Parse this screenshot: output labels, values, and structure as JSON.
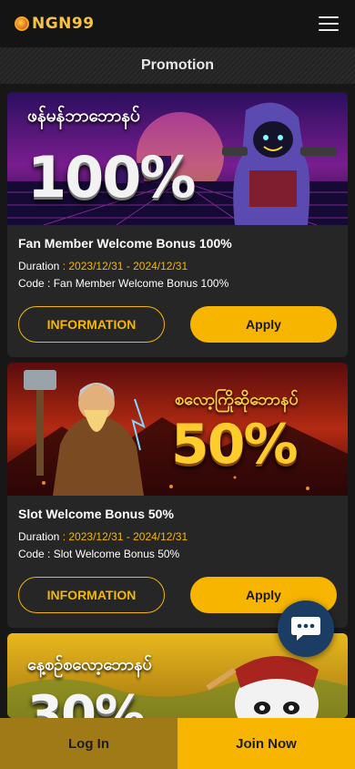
{
  "brand": {
    "logo_text": "NGN99"
  },
  "header": {
    "title": "Promotion"
  },
  "labels": {
    "duration": "Duration",
    "code": "Code",
    "separator": " : ",
    "info_button": "INFORMATION",
    "apply_button": "Apply"
  },
  "promotions": [
    {
      "title": "Fan Member Welcome Bonus 100%",
      "duration": "2023/12/31 - 2024/12/31",
      "code": "Fan Member Welcome Bonus 100%",
      "banner_percent": "100%",
      "banner_heading": "ဖန်မန်ဘာဘောနပ်"
    },
    {
      "title": "Slot Welcome Bonus 50%",
      "duration": "2023/12/31 - 2024/12/31",
      "code": "Slot Welcome Bonus 50%",
      "banner_percent": "50%",
      "banner_heading": "စလော့ကြိုဆိုဘောနပ်"
    },
    {
      "banner_percent": "30%",
      "banner_heading": "နေ့စဉ်စလော့ဘောနပ်"
    }
  ],
  "bottom_nav": {
    "login": "Log In",
    "join": "Join Now"
  },
  "colors": {
    "accent": "#f7b500",
    "background": "#171717",
    "card": "#262626",
    "chat": "#1b3d64"
  },
  "icons": {
    "menu": "hamburger-menu-icon",
    "chat": "chat-bubble-icon",
    "logo": "ngn99-logo"
  }
}
